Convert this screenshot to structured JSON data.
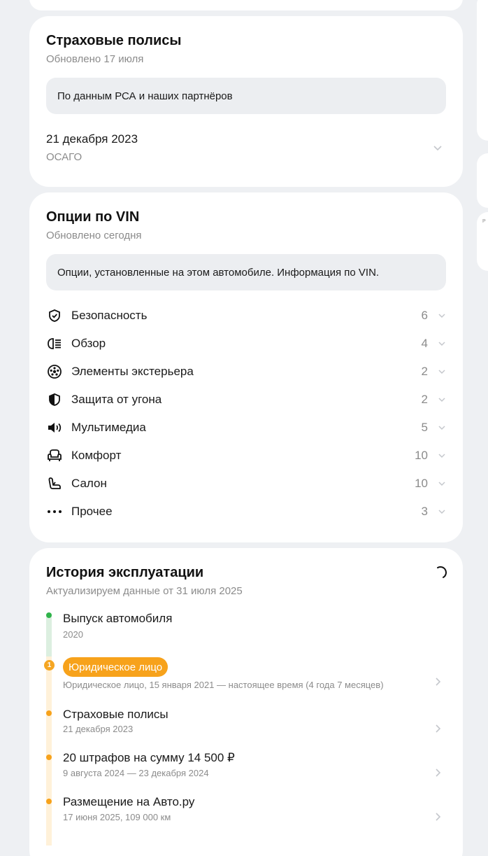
{
  "insurance": {
    "title": "Страховые полисы",
    "updated": "Обновлено 17 июля",
    "note": "По данным РСА и наших партнёров",
    "policy": {
      "date": "21 декабря 2023",
      "type": "ОСАГО"
    }
  },
  "options": {
    "title": "Опции по VIN",
    "updated": "Обновлено сегодня",
    "note": "Опции, установленные на этом автомобиле. Информация по VIN.",
    "items": [
      {
        "label": "Безопасность",
        "count": "6",
        "icon": "shield-check-icon"
      },
      {
        "label": "Обзор",
        "count": "4",
        "icon": "headlight-icon"
      },
      {
        "label": "Элементы экстерьера",
        "count": "2",
        "icon": "wheel-icon"
      },
      {
        "label": "Защита от угона",
        "count": "2",
        "icon": "shield-half-icon"
      },
      {
        "label": "Мультимедиа",
        "count": "5",
        "icon": "speaker-icon"
      },
      {
        "label": "Комфорт",
        "count": "10",
        "icon": "armchair-icon"
      },
      {
        "label": "Салон",
        "count": "10",
        "icon": "car-seat-icon"
      },
      {
        "label": "Прочее",
        "count": "3",
        "icon": "more-dots-icon"
      }
    ]
  },
  "history": {
    "title": "История эксплуатации",
    "updating": "Актуализируем данные от 31 июля 2025",
    "events": [
      {
        "title": "Выпуск автомобиля",
        "sub": "2020"
      },
      {
        "title": "Юридическое лицо",
        "sub": "Юридическое лицо, 15 января 2021 — настоящее время (4 года 7 месяцев)",
        "badge": "1"
      },
      {
        "title": "Страховые полисы",
        "sub": "21 декабря 2023"
      },
      {
        "title": "20 штрафов на сумму 14 500 ₽",
        "sub": "9 августа 2024 — 23 декабря 2024"
      },
      {
        "title": "Размещение на Авто.ру",
        "sub": "17 июня 2025, 109 000 км"
      }
    ]
  },
  "side": {
    "mini_label": "P"
  },
  "colors": {
    "accent_orange": "#f7a21b",
    "green_dot": "#2fb34a",
    "muted": "#8b8b8b",
    "background": "#eef0f3"
  }
}
